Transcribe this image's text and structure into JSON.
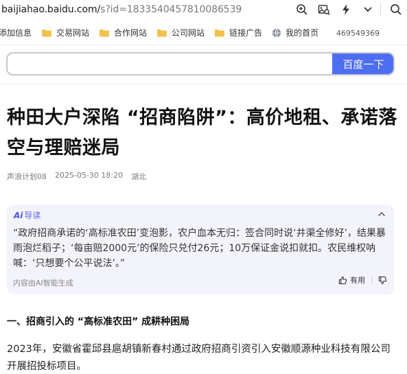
{
  "browser": {
    "url_host": "baijiahao.baidu.com/",
    "url_rest": "s?id=1833540457810086539",
    "icons": [
      "zoom-icon",
      "image-search-icon",
      "lightning-icon",
      "chevron-down-icon",
      "search-icon"
    ]
  },
  "bookmarks": {
    "first": "添加信息",
    "items": [
      "交易网站",
      "合作网站",
      "公司网站",
      "链接广告"
    ],
    "globe_item": "我的首页",
    "number": "469549369"
  },
  "search": {
    "value": "",
    "button_label": "百度一下"
  },
  "article": {
    "title": "种田大户深陷 “招商陷阱”：高价地租、承诺落空与理赔迷局",
    "author": "声浪计划08",
    "datetime": "2025-05-30 18:20",
    "location": "湖北"
  },
  "ai_card": {
    "badge": "Ai",
    "label": "导读",
    "text": "“政府招商承诺的‘高标准农田’变泡影，农户血本无归：签合同时说‘井渠全修好’，结果暴雨泡烂稻子；‘每亩赔2000元’的保险只兑付26元；10万保证金说扣就扣。农民维权呐喊：‘只想要个公平说法’。”",
    "footer": "内容由AI智能生成",
    "useful_label": "有用"
  },
  "section": {
    "heading": "一、招商引入的 “高标准农田” 成耕种困局",
    "paragraph": "2023年，安徽省霍邱县扈胡镇新春村通过政府招商引资引入安徽顺源种业科技有限公司开展招投标项目。"
  },
  "colors": {
    "accent": "#4e6ef2",
    "ai_bg": "#f3f4fb",
    "folder": "#f2c14e"
  }
}
